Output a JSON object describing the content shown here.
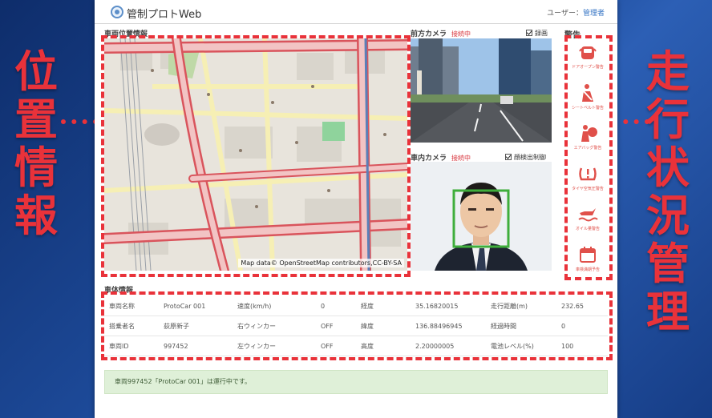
{
  "annotations": {
    "left_label": [
      "位",
      "置",
      "情",
      "報"
    ],
    "right_label": [
      "走",
      "行",
      "状",
      "況",
      "管",
      "理"
    ]
  },
  "header": {
    "app_title": "管制プロトWeb",
    "user_label": "ユーザー：",
    "user_name": "管理者"
  },
  "map_section": {
    "title": "車両位置情報",
    "attribution": "Map data© OpenStreetMap contributors,CC-BY-SA"
  },
  "front_camera": {
    "title": "前方カメラ",
    "status": "接続中",
    "checkbox_label": "録画",
    "checked": true
  },
  "cabin_camera": {
    "title": "車内カメラ",
    "status": "接続中",
    "checkbox_label": "顔検出制御",
    "checked": true
  },
  "alerts": {
    "title": "警告",
    "items": [
      {
        "icon": "door-open-icon",
        "label": "ドアオープン警告"
      },
      {
        "icon": "seatbelt-icon",
        "label": "シートベルト警告"
      },
      {
        "icon": "airbag-icon",
        "label": "エアバッグ警告"
      },
      {
        "icon": "tire-pressure-icon",
        "label": "タイヤ空気圧警告"
      },
      {
        "icon": "oil-level-icon",
        "label": "オイル量警告"
      },
      {
        "icon": "calendar-icon",
        "label": "車検満期予告"
      }
    ]
  },
  "vehicle_info": {
    "title": "車体情報",
    "rows": [
      [
        "車両名称",
        "ProtoCar 001",
        "速度(km/h)",
        "0",
        "経度",
        "35.16820015",
        "走行距離(m)",
        "232.65"
      ],
      [
        "搭乗者名",
        "荻原新子",
        "右ウィンカー",
        "OFF",
        "緯度",
        "136.88496945",
        "経過時間",
        "0"
      ],
      [
        "車両ID",
        "997452",
        "左ウィンカー",
        "OFF",
        "高度",
        "2.20000005",
        "電池レベル(%)",
        "100"
      ]
    ]
  },
  "status_message": "車両997452「ProtoCar 001」は運行中です。",
  "colors": {
    "accent_red": "#e9323a",
    "link_blue": "#3574c4",
    "status_green": "#dff0d8",
    "face_box": "#3fae3b"
  }
}
